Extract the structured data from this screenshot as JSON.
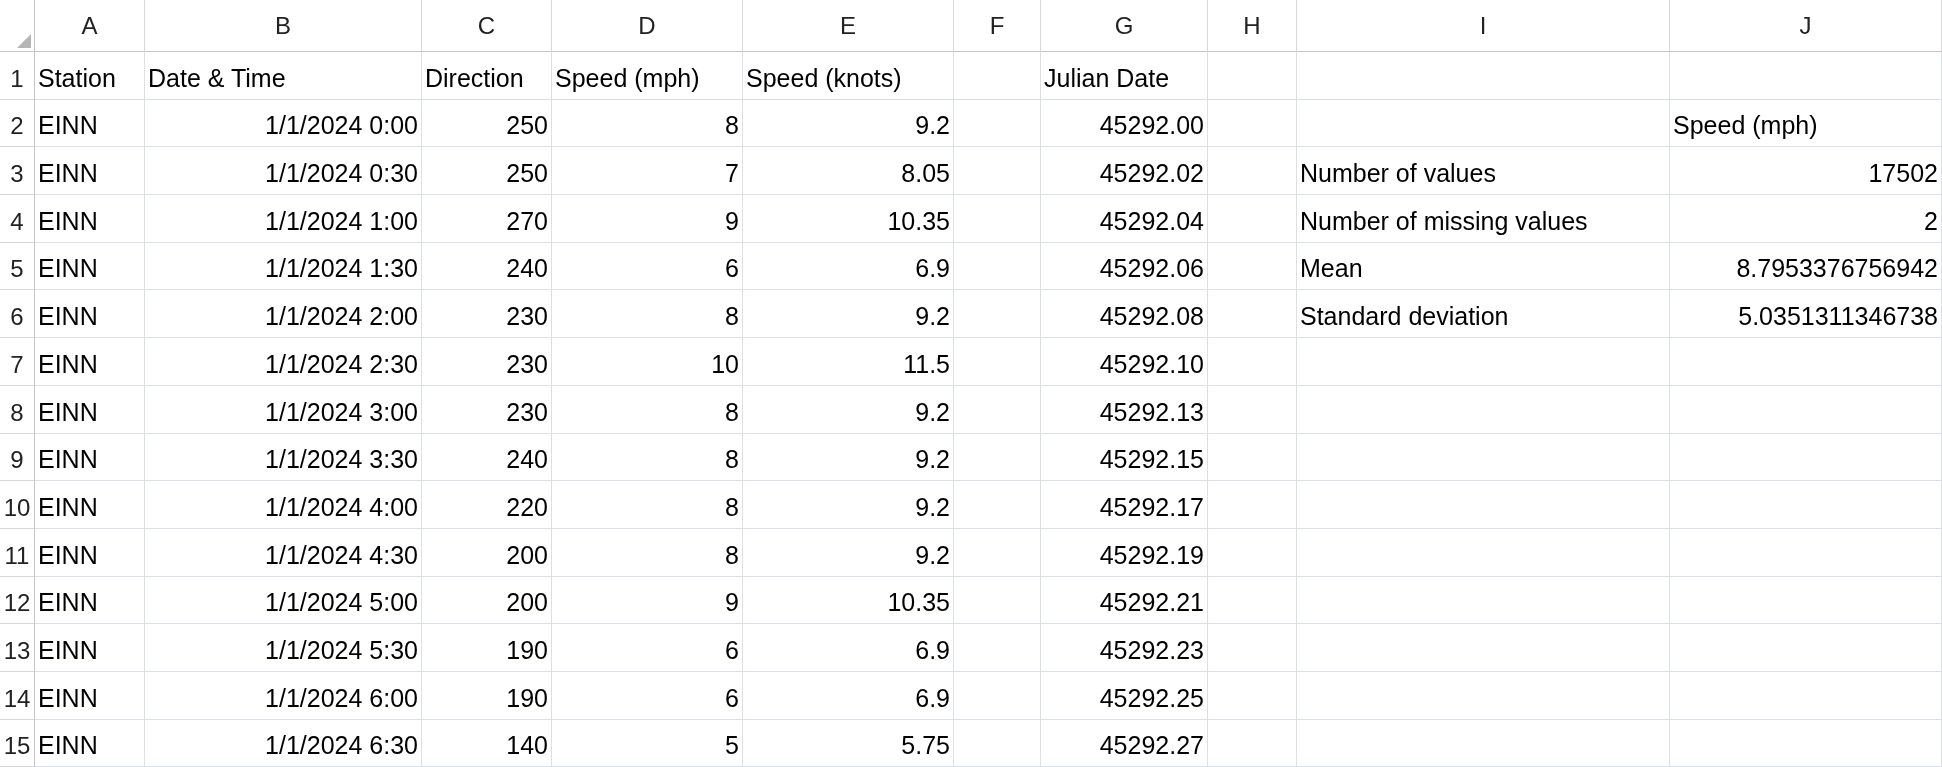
{
  "columns": [
    "A",
    "B",
    "C",
    "D",
    "E",
    "F",
    "G",
    "H",
    "I",
    "J"
  ],
  "rows": [
    {
      "number": "1",
      "cells": [
        {
          "text": "Station",
          "kind": "text"
        },
        {
          "text": "Date & Time",
          "kind": "text"
        },
        {
          "text": "Direction",
          "kind": "text"
        },
        {
          "text": "Speed (mph)",
          "kind": "text"
        },
        {
          "text": "Speed (knots)",
          "kind": "text"
        },
        null,
        {
          "text": "Julian Date",
          "kind": "text"
        },
        null,
        null,
        null
      ]
    },
    {
      "number": "2",
      "cells": [
        {
          "text": "EINN",
          "kind": "text"
        },
        {
          "text": "1/1/2024 0:00",
          "kind": "number"
        },
        {
          "text": "250",
          "kind": "number"
        },
        {
          "text": "8",
          "kind": "number"
        },
        {
          "text": "9.2",
          "kind": "number"
        },
        null,
        {
          "text": "45292.00",
          "kind": "number"
        },
        null,
        null,
        {
          "text": "Speed (mph)",
          "kind": "text"
        }
      ]
    },
    {
      "number": "3",
      "cells": [
        {
          "text": "EINN",
          "kind": "text"
        },
        {
          "text": "1/1/2024 0:30",
          "kind": "number"
        },
        {
          "text": "250",
          "kind": "number"
        },
        {
          "text": "7",
          "kind": "number"
        },
        {
          "text": "8.05",
          "kind": "number"
        },
        null,
        {
          "text": "45292.02",
          "kind": "number"
        },
        null,
        {
          "text": "Number of values",
          "kind": "text"
        },
        {
          "text": "17502",
          "kind": "number"
        }
      ]
    },
    {
      "number": "4",
      "cells": [
        {
          "text": "EINN",
          "kind": "text"
        },
        {
          "text": "1/1/2024 1:00",
          "kind": "number"
        },
        {
          "text": "270",
          "kind": "number"
        },
        {
          "text": "9",
          "kind": "number"
        },
        {
          "text": "10.35",
          "kind": "number"
        },
        null,
        {
          "text": "45292.04",
          "kind": "number"
        },
        null,
        {
          "text": "Number of missing values",
          "kind": "text"
        },
        {
          "text": "2",
          "kind": "number"
        }
      ]
    },
    {
      "number": "5",
      "cells": [
        {
          "text": "EINN",
          "kind": "text"
        },
        {
          "text": "1/1/2024 1:30",
          "kind": "number"
        },
        {
          "text": "240",
          "kind": "number"
        },
        {
          "text": "6",
          "kind": "number"
        },
        {
          "text": "6.9",
          "kind": "number"
        },
        null,
        {
          "text": "45292.06",
          "kind": "number"
        },
        null,
        {
          "text": "Mean",
          "kind": "text"
        },
        {
          "text": "8.7953376756942",
          "kind": "number"
        }
      ]
    },
    {
      "number": "6",
      "cells": [
        {
          "text": "EINN",
          "kind": "text"
        },
        {
          "text": "1/1/2024 2:00",
          "kind": "number"
        },
        {
          "text": "230",
          "kind": "number"
        },
        {
          "text": "8",
          "kind": "number"
        },
        {
          "text": "9.2",
          "kind": "number"
        },
        null,
        {
          "text": "45292.08",
          "kind": "number"
        },
        null,
        {
          "text": "Standard deviation",
          "kind": "text"
        },
        {
          "text": "5.0351311346738",
          "kind": "number"
        }
      ]
    },
    {
      "number": "7",
      "cells": [
        {
          "text": "EINN",
          "kind": "text"
        },
        {
          "text": "1/1/2024 2:30",
          "kind": "number"
        },
        {
          "text": "230",
          "kind": "number"
        },
        {
          "text": "10",
          "kind": "number"
        },
        {
          "text": "11.5",
          "kind": "number"
        },
        null,
        {
          "text": "45292.10",
          "kind": "number"
        },
        null,
        null,
        null
      ]
    },
    {
      "number": "8",
      "cells": [
        {
          "text": "EINN",
          "kind": "text"
        },
        {
          "text": "1/1/2024 3:00",
          "kind": "number"
        },
        {
          "text": "230",
          "kind": "number"
        },
        {
          "text": "8",
          "kind": "number"
        },
        {
          "text": "9.2",
          "kind": "number"
        },
        null,
        {
          "text": "45292.13",
          "kind": "number"
        },
        null,
        null,
        null
      ]
    },
    {
      "number": "9",
      "cells": [
        {
          "text": "EINN",
          "kind": "text"
        },
        {
          "text": "1/1/2024 3:30",
          "kind": "number"
        },
        {
          "text": "240",
          "kind": "number"
        },
        {
          "text": "8",
          "kind": "number"
        },
        {
          "text": "9.2",
          "kind": "number"
        },
        null,
        {
          "text": "45292.15",
          "kind": "number"
        },
        null,
        null,
        null
      ]
    },
    {
      "number": "10",
      "cells": [
        {
          "text": "EINN",
          "kind": "text"
        },
        {
          "text": "1/1/2024 4:00",
          "kind": "number"
        },
        {
          "text": "220",
          "kind": "number"
        },
        {
          "text": "8",
          "kind": "number"
        },
        {
          "text": "9.2",
          "kind": "number"
        },
        null,
        {
          "text": "45292.17",
          "kind": "number"
        },
        null,
        null,
        null
      ]
    },
    {
      "number": "11",
      "cells": [
        {
          "text": "EINN",
          "kind": "text"
        },
        {
          "text": "1/1/2024 4:30",
          "kind": "number"
        },
        {
          "text": "200",
          "kind": "number"
        },
        {
          "text": "8",
          "kind": "number"
        },
        {
          "text": "9.2",
          "kind": "number"
        },
        null,
        {
          "text": "45292.19",
          "kind": "number"
        },
        null,
        null,
        null
      ]
    },
    {
      "number": "12",
      "cells": [
        {
          "text": "EINN",
          "kind": "text"
        },
        {
          "text": "1/1/2024 5:00",
          "kind": "number"
        },
        {
          "text": "200",
          "kind": "number"
        },
        {
          "text": "9",
          "kind": "number"
        },
        {
          "text": "10.35",
          "kind": "number"
        },
        null,
        {
          "text": "45292.21",
          "kind": "number"
        },
        null,
        null,
        null
      ]
    },
    {
      "number": "13",
      "cells": [
        {
          "text": "EINN",
          "kind": "text"
        },
        {
          "text": "1/1/2024 5:30",
          "kind": "number"
        },
        {
          "text": "190",
          "kind": "number"
        },
        {
          "text": "6",
          "kind": "number"
        },
        {
          "text": "6.9",
          "kind": "number"
        },
        null,
        {
          "text": "45292.23",
          "kind": "number"
        },
        null,
        null,
        null
      ]
    },
    {
      "number": "14",
      "cells": [
        {
          "text": "EINN",
          "kind": "text"
        },
        {
          "text": "1/1/2024 6:00",
          "kind": "number"
        },
        {
          "text": "190",
          "kind": "number"
        },
        {
          "text": "6",
          "kind": "number"
        },
        {
          "text": "6.9",
          "kind": "number"
        },
        null,
        {
          "text": "45292.25",
          "kind": "number"
        },
        null,
        null,
        null
      ]
    },
    {
      "number": "15",
      "cells": [
        {
          "text": "EINN",
          "kind": "text"
        },
        {
          "text": "1/1/2024 6:30",
          "kind": "number"
        },
        {
          "text": "140",
          "kind": "number"
        },
        {
          "text": "5",
          "kind": "number"
        },
        {
          "text": "5.75",
          "kind": "number"
        },
        null,
        {
          "text": "45292.27",
          "kind": "number"
        },
        null,
        null,
        null
      ]
    }
  ]
}
